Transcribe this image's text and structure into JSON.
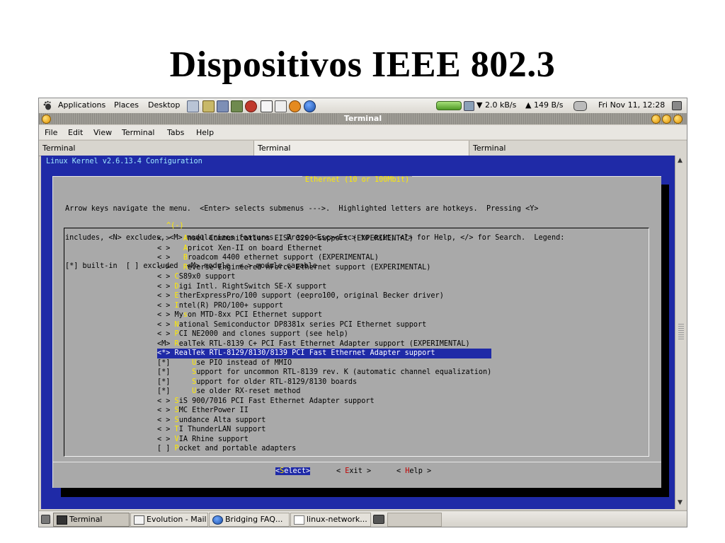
{
  "slide_title": "Dispositivos IEEE 802.3",
  "top_panel": {
    "menus": [
      "Applications",
      "Places",
      "Desktop"
    ],
    "net_down": "2.0 kB/s",
    "net_up": "149 B/s",
    "clock": "Fri Nov 11, 12:28",
    "net_down_arrow": "▼",
    "net_up_arrow": "▲"
  },
  "window": {
    "title": "Terminal",
    "menu": [
      "File",
      "Edit",
      "View",
      "Terminal",
      "Tabs",
      "Help"
    ],
    "tabs": [
      "Terminal",
      "Terminal",
      "Terminal"
    ],
    "active_tab": 1
  },
  "terminal": {
    "header": "Linux Kernel v2.6.13.4 Configuration",
    "dialog_title": "Ethernet (10 or 100Mbit)",
    "help_lines": [
      "Arrow keys navigate the menu.  <Enter> selects submenus --->.  Highlighted letters are hotkeys.  Pressing <Y>",
      "includes, <N> excludes, <M> modularizes features.  Press <Esc><Esc> to exit, <?> for Help, </> for Search.  Legend:",
      "[*] built-in  [ ] excluded  <M> module  < > module capable"
    ],
    "more_above": "^(-)",
    "items": [
      {
        "prefix": "< >   ",
        "hk": "A",
        "rest": "nsel Communications EISA 3200 support (EXPERIMENTAL)"
      },
      {
        "prefix": "< >   ",
        "hk": "A",
        "rest": "pricot Xen-II on board Ethernet"
      },
      {
        "prefix": "< >   ",
        "hk": "B",
        "rest": "roadcom 4400 ethernet support (EXPERIMENTAL)"
      },
      {
        "prefix": "< >   ",
        "hk": "R",
        "rest": "everse Engineered nForce Ethernet support (EXPERIMENTAL)"
      },
      {
        "prefix": "< > ",
        "hk": "C",
        "rest": "S89x0 support"
      },
      {
        "prefix": "< > ",
        "hk": "D",
        "rest": "igi Intl. RightSwitch SE-X support"
      },
      {
        "prefix": "< > ",
        "hk": "E",
        "rest": "therExpressPro/100 support (eepro100, original Becker driver)"
      },
      {
        "prefix": "< > ",
        "hk": "I",
        "rest": "ntel(R) PRO/100+ support"
      },
      {
        "prefix": "< > My",
        "hk": "s",
        "rest": "on MTD-8xx PCI Ethernet support"
      },
      {
        "prefix": "< > ",
        "hk": "N",
        "rest": "ational Semiconductor DP8381x series PCI Ethernet support"
      },
      {
        "prefix": "< > ",
        "hk": "P",
        "rest": "CI NE2000 and clones support (see help)"
      },
      {
        "prefix": "<M> ",
        "hk": "R",
        "rest": "ealTek RTL-8139 C+ PCI Fast Ethernet Adapter support (EXPERIMENTAL)"
      },
      {
        "prefix": "<*> ",
        "hk": "R",
        "rest": "ealTek RTL-8129/8130/8139 PCI Fast Ethernet Adapter support",
        "selected": true
      },
      {
        "prefix": "[*]     ",
        "hk": "U",
        "rest": "se PIO instead of MMIO"
      },
      {
        "prefix": "[*]     ",
        "hk": "S",
        "rest": "upport for uncommon RTL-8139 rev. K (automatic channel equalization)"
      },
      {
        "prefix": "[*]     ",
        "hk": "S",
        "rest": "upport for older RTL-8129/8130 boards"
      },
      {
        "prefix": "[*]     ",
        "hk": "U",
        "rest": "se older RX-reset method"
      },
      {
        "prefix": "< > ",
        "hk": "S",
        "rest": "iS 900/7016 PCI Fast Ethernet Adapter support"
      },
      {
        "prefix": "< > ",
        "hk": "S",
        "rest": "MC EtherPower II"
      },
      {
        "prefix": "< > ",
        "hk": "S",
        "rest": "undance Alta support"
      },
      {
        "prefix": "< > ",
        "hk": "T",
        "rest": "I ThunderLAN support"
      },
      {
        "prefix": "< > ",
        "hk": "V",
        "rest": "IA Rhine support"
      },
      {
        "prefix": "[ ] ",
        "hk": "P",
        "rest": "ocket and portable adapters"
      }
    ],
    "buttons": [
      {
        "pre": "<",
        "hk": "S",
        "rest": "elect>",
        "active": true
      },
      {
        "pre": "< ",
        "hk": "E",
        "rest": "xit >",
        "active": false
      },
      {
        "pre": "< ",
        "hk": "H",
        "rest": "elp >",
        "active": false
      }
    ]
  },
  "taskbar": {
    "items": [
      {
        "label": "Terminal",
        "icon": "terminal-icon",
        "active": true
      },
      {
        "label": "Evolution - Mail",
        "icon": "mail-icon",
        "active": false
      },
      {
        "label": "Bridging FAQ...",
        "icon": "globe-icon",
        "active": false
      },
      {
        "label": "linux-network...",
        "icon": "document-icon",
        "active": false
      }
    ]
  },
  "colors": {
    "terminal_bg": "#1f2aa7",
    "dialog_bg": "#a9a9a9",
    "hotkey": "#ffea00",
    "header_text": "#9fe8ff"
  }
}
